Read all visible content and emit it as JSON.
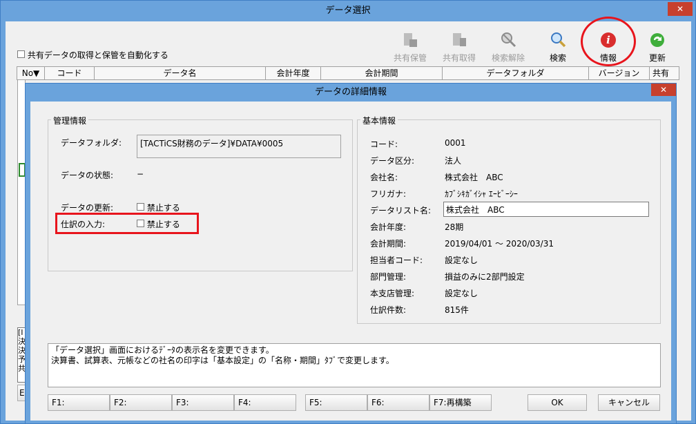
{
  "outer_window": {
    "title": "データ選択",
    "close_label": "✕",
    "auto_checkbox_label": "共有データの取得と保管を自動化する",
    "toolbar": [
      {
        "label": "共有保管",
        "icon": "share-store-icon",
        "enabled": false
      },
      {
        "label": "共有取得",
        "icon": "share-get-icon",
        "enabled": false
      },
      {
        "label": "検索解除",
        "icon": "search-clear-icon",
        "enabled": false
      },
      {
        "label": "検索",
        "icon": "search-icon",
        "enabled": true
      },
      {
        "label": "情報",
        "icon": "info-icon",
        "enabled": true
      },
      {
        "label": "更新",
        "icon": "refresh-icon",
        "enabled": true
      }
    ],
    "grid_columns": [
      "No▼",
      "コード",
      "データ名",
      "会計年度",
      "会計期間",
      "データフォルダ",
      "バージョン",
      "共有"
    ],
    "bottom_left_button": "E",
    "side_text": "[I\n決\n決\n予\n共"
  },
  "dialog": {
    "title": "データの詳細情報",
    "close_label": "✕",
    "management": {
      "title": "管理情報",
      "folder_label": "データフォルダ:",
      "folder_value": "[TACTiCS財務のデータ]¥DATA¥0005",
      "status_label": "データの状態:",
      "status_value": "−",
      "update_label": "データの更新:",
      "update_checkbox": "禁止する",
      "entry_label": "仕訳の入力:",
      "entry_checkbox": "禁止する"
    },
    "basic": {
      "title": "基本情報",
      "rows": [
        {
          "label": "コード:",
          "value": "0001"
        },
        {
          "label": "データ区分:",
          "value": "法人"
        },
        {
          "label": "会社名:",
          "value": "株式会社　ABC"
        },
        {
          "label": "フリガナ:",
          "value": "ｶﾌﾞｼｷｶﾞｲｼｬ ｴｰﾋﾞｰｼｰ"
        },
        {
          "label": "データリスト名:",
          "value": "株式会社　ABC"
        },
        {
          "label": "会計年度:",
          "value": "28期"
        },
        {
          "label": "会計期間:",
          "value": "2019/04/01 〜 2020/03/31"
        },
        {
          "label": "担当者コード:",
          "value": "設定なし"
        },
        {
          "label": "部門管理:",
          "value": "損益のみに2部門設定"
        },
        {
          "label": "本支店管理:",
          "value": "設定なし"
        },
        {
          "label": "仕訳件数:",
          "value": "815件"
        }
      ]
    },
    "message_line1": "「データ選択」画面におけるﾃﾞｰﾀの表示名を変更できます。",
    "message_line2": "決算書、試算表、元帳などの社名の印字は「基本設定」の「名称・期間」ﾀﾌﾞで変更します。",
    "fkeys": [
      "F1:",
      "F2:",
      "F3:",
      "F4:",
      "F5:",
      "F6:",
      "F7:再構築"
    ],
    "ok_label": "OK",
    "cancel_label": "キャンセル"
  },
  "colors": {
    "highlight": "#e8141c",
    "title_bar": "#6aa3dc",
    "close": "#c7402d"
  }
}
